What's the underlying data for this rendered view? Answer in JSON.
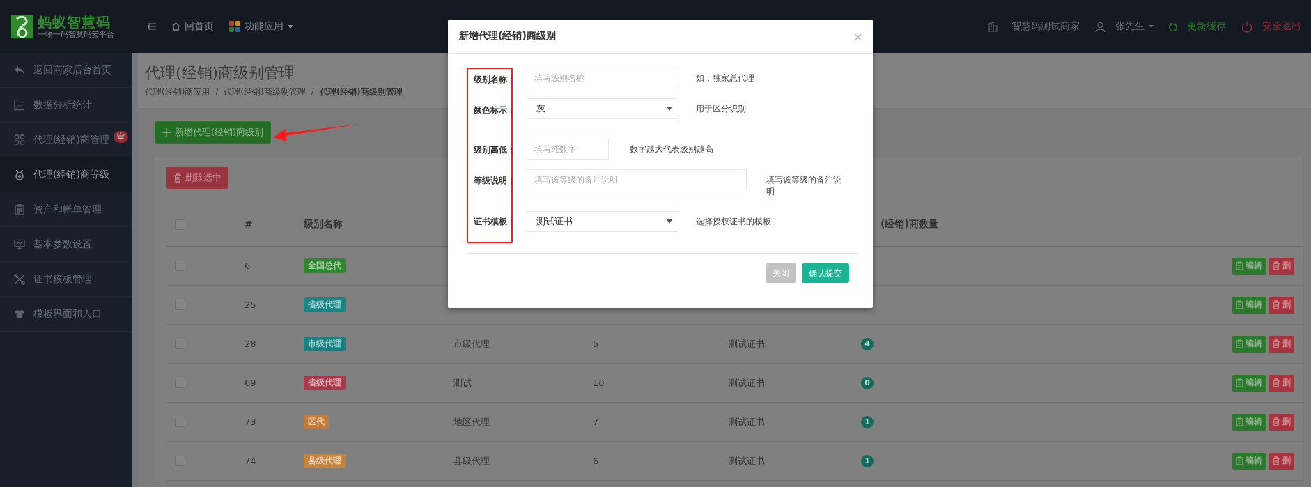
{
  "topbar": {
    "logo_title": "蚂蚁智慧码",
    "logo_subtitle": "一物一码智慧码云平台",
    "home": "回首页",
    "apps": "功能应用",
    "merchant": "智慧码测试商家",
    "user": "张先生",
    "refresh": "更新缓存",
    "logout": "安全退出"
  },
  "sidebar": {
    "items": [
      {
        "kind": "back",
        "label": "返回商家后台首页",
        "selected": false
      },
      {
        "kind": "stats",
        "label": "数据分析统计",
        "selected": false
      },
      {
        "kind": "agents",
        "label": "代理(经销)商管理",
        "badge": "审",
        "selected": false
      },
      {
        "kind": "levels",
        "label": "代理(经销)商等级",
        "selected": true
      },
      {
        "kind": "billing",
        "label": "资产和帐单管理",
        "selected": false
      },
      {
        "kind": "settings",
        "label": "基本参数设置",
        "selected": false
      },
      {
        "kind": "certificates",
        "label": "证书模板管理",
        "selected": false
      },
      {
        "kind": "templates",
        "label": "模板界面和入口",
        "selected": false
      }
    ]
  },
  "page": {
    "title": "代理(经销)商级别管理",
    "breadcrumb": [
      "代理(经销)商应用",
      "代理(经销)商级别管理",
      "代理(经销)商级别管理"
    ],
    "breadcrumb_separator": "/",
    "add_button": "新增代理(经销)商级别",
    "delete_selected": "删除选中"
  },
  "table": {
    "header": {
      "checked": false,
      "number": "#",
      "name": "级别名称",
      "count": "(经销)商数量"
    },
    "rows": [
      {
        "checked": false,
        "number": "6",
        "tag": "全国总代",
        "color": "#2e862e",
        "edit": "编辑",
        "delete": "删"
      },
      {
        "checked": false,
        "number": "25",
        "tag": "省级代理",
        "color": "#1a8585",
        "edit": "编辑",
        "delete": "删"
      },
      {
        "checked": false,
        "number": "28",
        "tag": "市级代理",
        "color": "#178080",
        "description": "市级代理",
        "rank": "5",
        "certificate": "测试证书",
        "count": "4",
        "edit": "编辑",
        "delete": "删"
      },
      {
        "checked": false,
        "number": "69",
        "tag": "省级代理",
        "color": "#a8394a",
        "description": "测试",
        "rank": "10",
        "certificate": "测试证书",
        "count": "0",
        "edit": "编辑",
        "delete": "删"
      },
      {
        "checked": false,
        "number": "73",
        "tag": "区代",
        "color": "#c07c38",
        "description": "地区代理",
        "rank": "7",
        "certificate": "测试证书",
        "count": "1",
        "edit": "编辑",
        "delete": "删"
      },
      {
        "checked": false,
        "number": "74",
        "tag": "县级代理",
        "color": "#c3843e",
        "description": "县级代理",
        "rank": "6",
        "certificate": "测试证书",
        "count": "1",
        "edit": "编辑",
        "delete": "删"
      }
    ]
  },
  "modal": {
    "title": "新增代理(经销)商级别",
    "close_icon": "×",
    "fields": [
      {
        "kind": "text",
        "label": "级别名称：",
        "placeholder": "填写级别名称",
        "hint": "如：独家总代理"
      },
      {
        "kind": "select",
        "label": "颜色标示：",
        "value": "灰",
        "hint": "用于区分识别"
      },
      {
        "kind": "short",
        "label": "级别高低：",
        "placeholder": "填写纯数字",
        "hint": "数字越大代表级别越高"
      },
      {
        "kind": "wide",
        "label": "等级说明：",
        "placeholder": "填写该等级的备注说明",
        "hint": "填写该等级的备注说明"
      },
      {
        "kind": "select",
        "label": "证书模板：",
        "value": "测试证书",
        "hint": "选择授权证书的模板"
      }
    ],
    "close": "关闭",
    "submit": "确认提交"
  }
}
